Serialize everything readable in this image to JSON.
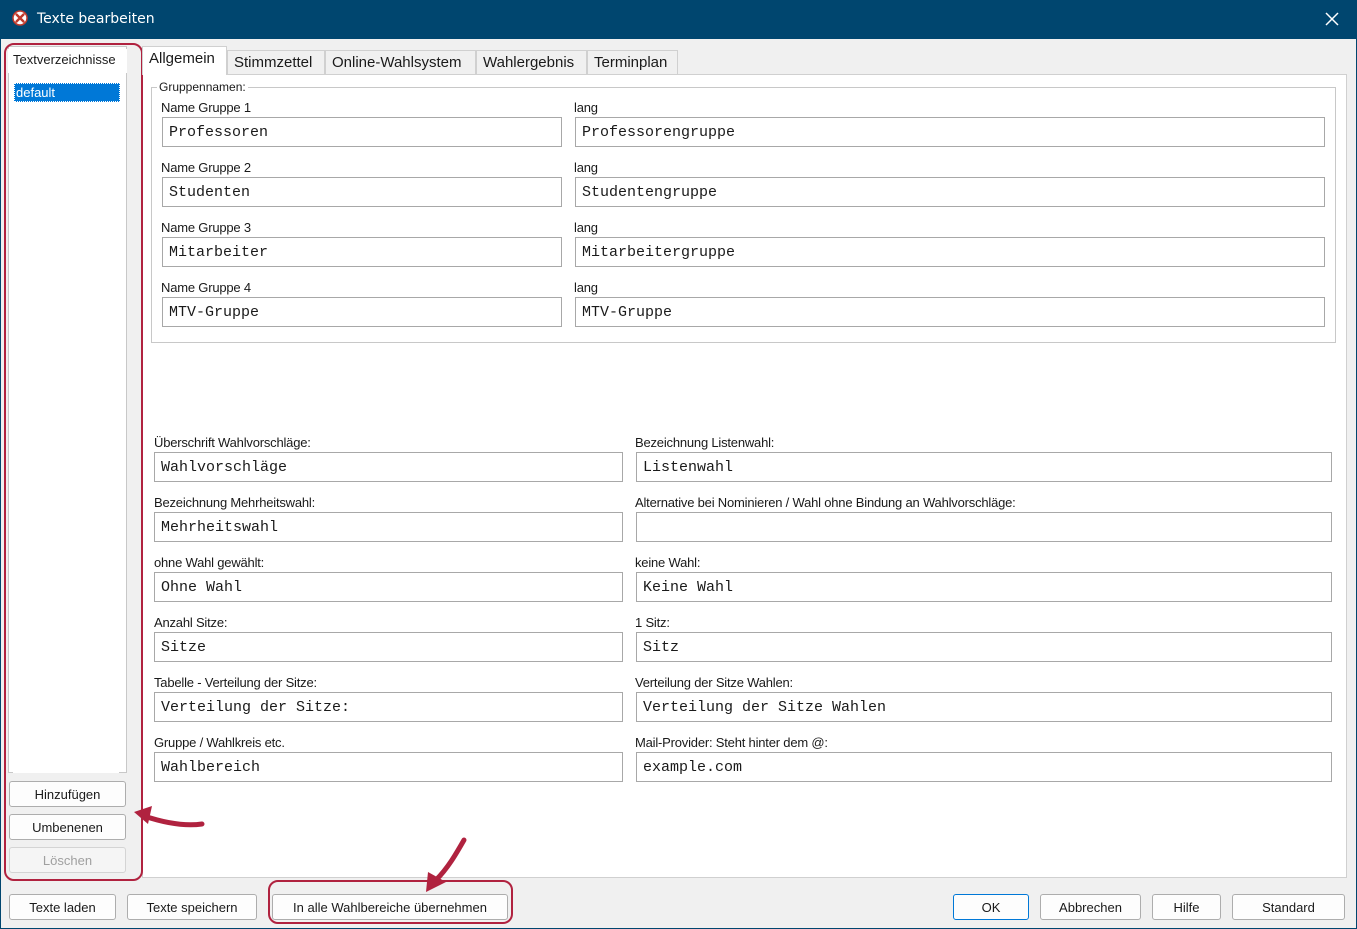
{
  "window": {
    "title": "Texte bearbeiten"
  },
  "left": {
    "tab_label": "Textverzeichnisse",
    "items": [
      "default"
    ],
    "add_label": "Hinzufügen",
    "rename_label": "Umbenenen",
    "delete_label": "Löschen"
  },
  "tabs": [
    "Allgemein",
    "Stimmzettel",
    "Online-Wahlsystem",
    "Wahlergebnis",
    "Terminplan"
  ],
  "groupbox": {
    "legend": "Gruppennamen:",
    "rows": [
      {
        "name_label": "Name Gruppe 1",
        "name_value": "Professoren",
        "long_label": "lang",
        "long_value": "Professorengruppe"
      },
      {
        "name_label": "Name Gruppe 2",
        "name_value": "Studenten",
        "long_label": "lang",
        "long_value": "Studentengruppe"
      },
      {
        "name_label": "Name Gruppe 3",
        "name_value": "Mitarbeiter",
        "long_label": "lang",
        "long_value": "Mitarbeitergruppe"
      },
      {
        "name_label": "Name Gruppe 4",
        "name_value": "MTV-Gruppe",
        "long_label": "lang",
        "long_value": "MTV-Gruppe"
      }
    ]
  },
  "fields": [
    {
      "left_label": "Überschrift Wahlvorschläge:",
      "left_value": "Wahlvorschläge",
      "right_label": "Bezeichnung Listenwahl:",
      "right_value": "Listenwahl"
    },
    {
      "left_label": "Bezeichnung Mehrheitswahl:",
      "left_value": "Mehrheitswahl",
      "right_label": "Alternative bei Nominieren / Wahl ohne Bindung an Wahlvorschläge:",
      "right_value": ""
    },
    {
      "left_label": "ohne Wahl gewählt:",
      "left_value": "Ohne Wahl",
      "right_label": "keine Wahl:",
      "right_value": "Keine Wahl"
    },
    {
      "left_label": "Anzahl Sitze:",
      "left_value": "Sitze",
      "right_label": "1 Sitz:",
      "right_value": "Sitz"
    },
    {
      "left_label": "Tabelle - Verteilung der Sitze:",
      "left_value": "Verteilung der Sitze:",
      "right_label": "Verteilung der Sitze Wahlen:",
      "right_value": "Verteilung der Sitze Wahlen"
    },
    {
      "left_label": "Gruppe / Wahlkreis etc.",
      "left_value": "Wahlbereich",
      "right_label": "Mail-Provider: Steht hinter dem @:",
      "right_value": "example.com"
    }
  ],
  "footer": {
    "load_label": "Texte laden",
    "save_label": "Texte speichern",
    "apply_all_label": "In alle Wahlbereiche übernehmen",
    "ok_label": "OK",
    "cancel_label": "Abbrechen",
    "help_label": "Hilfe",
    "default_label": "Standard"
  },
  "colors": {
    "titlebar": "#00466f",
    "selection": "#0078d7",
    "annotation": "#b0223f"
  }
}
